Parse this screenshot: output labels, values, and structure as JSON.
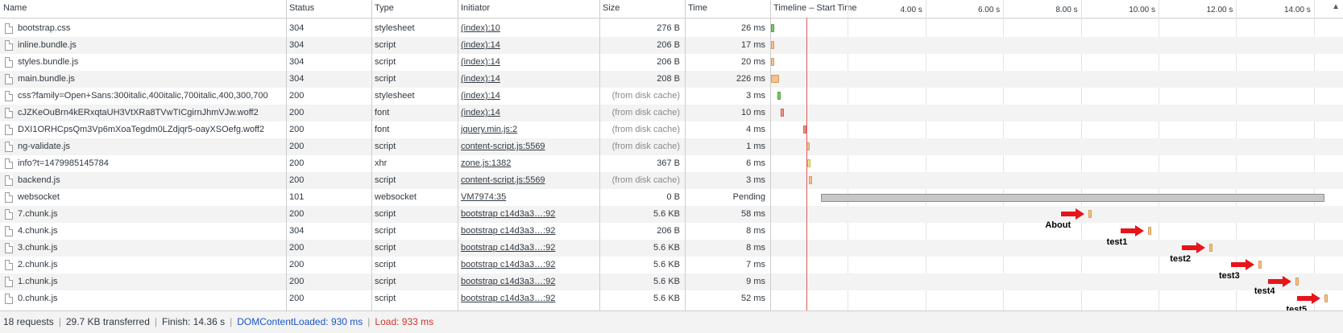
{
  "headers": {
    "name": "Name",
    "status": "Status",
    "type": "Type",
    "initiator": "Initiator",
    "size": "Size",
    "time": "Time",
    "timeline": "Timeline – Start Time"
  },
  "timeline_ticks": [
    "4.00 s",
    "6.00 s",
    "8.00 s",
    "10.00 s",
    "12.00 s",
    "14.00 s"
  ],
  "sort_indicator": "▲",
  "requests": [
    {
      "name": "bootstrap.css",
      "status": "304",
      "type": "stylesheet",
      "initiator": "(index):10",
      "size": "276 B",
      "time": "26 ms",
      "dim": false,
      "bar": {
        "kind": "green",
        "start": 0.02,
        "dur": 0.07
      }
    },
    {
      "name": "inline.bundle.js",
      "status": "304",
      "type": "script",
      "initiator": "(index):14",
      "size": "206 B",
      "time": "17 ms",
      "dim": false,
      "bar": {
        "kind": "orange",
        "start": 0.02,
        "dur": 0.06
      }
    },
    {
      "name": "styles.bundle.js",
      "status": "304",
      "type": "script",
      "initiator": "(index):14",
      "size": "206 B",
      "time": "20 ms",
      "dim": false,
      "bar": {
        "kind": "orange",
        "start": 0.02,
        "dur": 0.06
      }
    },
    {
      "name": "main.bundle.js",
      "status": "304",
      "type": "script",
      "initiator": "(index):14",
      "size": "208 B",
      "time": "226 ms",
      "dim": false,
      "bar": {
        "kind": "orange",
        "start": 0.02,
        "dur": 0.2
      }
    },
    {
      "name": "css?family=Open+Sans:300italic,400italic,700italic,400,300,700",
      "status": "200",
      "type": "stylesheet",
      "initiator": "(index):14",
      "size": "(from disk cache)",
      "time": "3 ms",
      "dim": true,
      "bar": {
        "kind": "green",
        "start": 0.18,
        "dur": 0.05
      }
    },
    {
      "name": "cJZKeOuBrn4kERxqtaUH3VtXRa8TVwTICgirnJhmVJw.woff2",
      "status": "200",
      "type": "font",
      "initiator": "(index):14",
      "size": "(from disk cache)",
      "time": "10 ms",
      "dim": true,
      "bar": {
        "kind": "orangered",
        "start": 0.28,
        "dur": 0.06
      }
    },
    {
      "name": "DXI1ORHCpsQm3Vp6mXoaTegdm0LZdjqr5-oayXSOefg.woff2",
      "status": "200",
      "type": "font",
      "initiator": "jquery.min.js:2",
      "size": "(from disk cache)",
      "time": "4 ms",
      "dim": true,
      "bar": {
        "kind": "orangered",
        "start": 0.86,
        "dur": 0.05
      }
    },
    {
      "name": "ng-validate.js",
      "status": "200",
      "type": "script",
      "initiator": "content-script.js:5569",
      "size": "(from disk cache)",
      "time": "1 ms",
      "dim": true,
      "bar": {
        "kind": "orange",
        "start": 0.94,
        "dur": 0.05
      }
    },
    {
      "name": "info?t=1479985145784",
      "status": "200",
      "type": "xhr",
      "initiator": "zone.js:1382",
      "size": "367 B",
      "time": "6 ms",
      "dim": false,
      "bar": {
        "kind": "yellow",
        "start": 0.96,
        "dur": 0.06
      }
    },
    {
      "name": "backend.js",
      "status": "200",
      "type": "script",
      "initiator": "content-script.js:5569",
      "size": "(from disk cache)",
      "time": "3 ms",
      "dim": true,
      "bar": {
        "kind": "orange",
        "start": 1.0,
        "dur": 0.05
      }
    },
    {
      "name": "websocket",
      "status": "101",
      "type": "websocket",
      "initiator": "VM7974:35",
      "size": "0 B",
      "time": "Pending",
      "dim": false,
      "bar": {
        "kind": "grey",
        "start": 1.3,
        "dur": 12.97
      }
    },
    {
      "name": "7.chunk.js",
      "status": "200",
      "type": "script",
      "initiator": "bootstrap c14d3a3…:92",
      "size": "5.6 KB",
      "time": "58 ms",
      "dim": false,
      "bar": {
        "kind": "orange",
        "start": 8.2,
        "dur": 0.08
      }
    },
    {
      "name": "4.chunk.js",
      "status": "304",
      "type": "script",
      "initiator": "bootstrap c14d3a3…:92",
      "size": "206 B",
      "time": "8 ms",
      "dim": false,
      "bar": {
        "kind": "orange",
        "start": 9.72,
        "dur": 0.06
      }
    },
    {
      "name": "3.chunk.js",
      "status": "200",
      "type": "script",
      "initiator": "bootstrap c14d3a3…:92",
      "size": "5.6 KB",
      "time": "8 ms",
      "dim": false,
      "bar": {
        "kind": "orange",
        "start": 11.31,
        "dur": 0.06
      }
    },
    {
      "name": "2.chunk.js",
      "status": "200",
      "type": "script",
      "initiator": "bootstrap c14d3a3…:92",
      "size": "5.6 KB",
      "time": "7 ms",
      "dim": false,
      "bar": {
        "kind": "orange",
        "start": 12.57,
        "dur": 0.06
      }
    },
    {
      "name": "1.chunk.js",
      "status": "200",
      "type": "script",
      "initiator": "bootstrap c14d3a3…:92",
      "size": "5.6 KB",
      "time": "9 ms",
      "dim": false,
      "bar": {
        "kind": "orange",
        "start": 13.52,
        "dur": 0.06
      }
    },
    {
      "name": "0.chunk.js",
      "status": "200",
      "type": "script",
      "initiator": "bootstrap c14d3a3…:92",
      "size": "5.6 KB",
      "time": "52 ms",
      "dim": false,
      "bar": {
        "kind": "orange",
        "start": 14.28,
        "dur": 0.08
      }
    }
  ],
  "annotations": [
    "About",
    "test1",
    "test2",
    "test3",
    "test4",
    "test5"
  ],
  "footer": {
    "requests": "18 requests",
    "transferred": "29.7 KB transferred",
    "finish": "Finish: 14.36 s",
    "dcl": "DOMContentLoaded: 930 ms",
    "load": "Load: 933 ms"
  },
  "colors": {
    "load_line": "#e05b5b",
    "dcl": "#1a55c6",
    "load": "#d0362e",
    "annotation_arrow": "#e8141b"
  }
}
